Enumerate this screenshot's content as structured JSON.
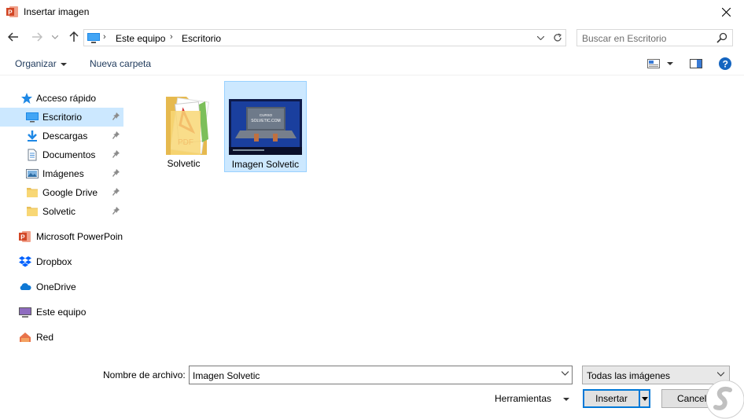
{
  "window": {
    "title": "Insertar imagen",
    "close_icon": "close-icon"
  },
  "navigation": {
    "back_icon": "arrow-left-icon",
    "forward_icon": "arrow-right-icon",
    "recent_icon": "chevron-down-icon",
    "up_icon": "arrow-up-icon",
    "breadcrumb": [
      "Este equipo",
      "Escritorio"
    ],
    "refresh_icon": "refresh-icon"
  },
  "search": {
    "placeholder": "Buscar en Escritorio"
  },
  "toolbar": {
    "organize_label": "Organizar",
    "new_folder_label": "Nueva carpeta"
  },
  "sidebar": {
    "quick_access": "Acceso rápido",
    "items": [
      {
        "label": "Escritorio",
        "icon": "desktop-icon",
        "pinned": true,
        "selected": true
      },
      {
        "label": "Descargas",
        "icon": "download-icon",
        "pinned": true
      },
      {
        "label": "Documentos",
        "icon": "document-icon",
        "pinned": true
      },
      {
        "label": "Imágenes",
        "icon": "pictures-icon",
        "pinned": true
      },
      {
        "label": "Google Drive",
        "icon": "folder-icon",
        "pinned": true
      },
      {
        "label": "Solvetic",
        "icon": "folder-icon",
        "pinned": true
      }
    ],
    "locations": [
      {
        "label": "Microsoft PowerPoin",
        "icon": "powerpoint-icon"
      },
      {
        "label": "Dropbox",
        "icon": "dropbox-icon"
      },
      {
        "label": "OneDrive",
        "icon": "onedrive-icon"
      },
      {
        "label": "Este equipo",
        "icon": "computer-icon"
      },
      {
        "label": "Red",
        "icon": "network-icon"
      }
    ]
  },
  "files": [
    {
      "name": "Solvetic",
      "type": "folder"
    },
    {
      "name": "Imagen Solvetic",
      "type": "image",
      "selected": true
    }
  ],
  "thumbnail": {
    "line1": "CURSO",
    "line2": "SOLVETIC.COM"
  },
  "footer": {
    "filename_label": "Nombre de archivo:",
    "filename_value": "Imagen Solvetic",
    "filetype_value": "Todas las imágenes",
    "tools_label": "Herramientas",
    "insert_label": "Insertar",
    "cancel_label": "Cancelar"
  },
  "colors": {
    "accent": "#0078d7",
    "selection": "#cce8ff",
    "powerpoint": "#d24726"
  }
}
